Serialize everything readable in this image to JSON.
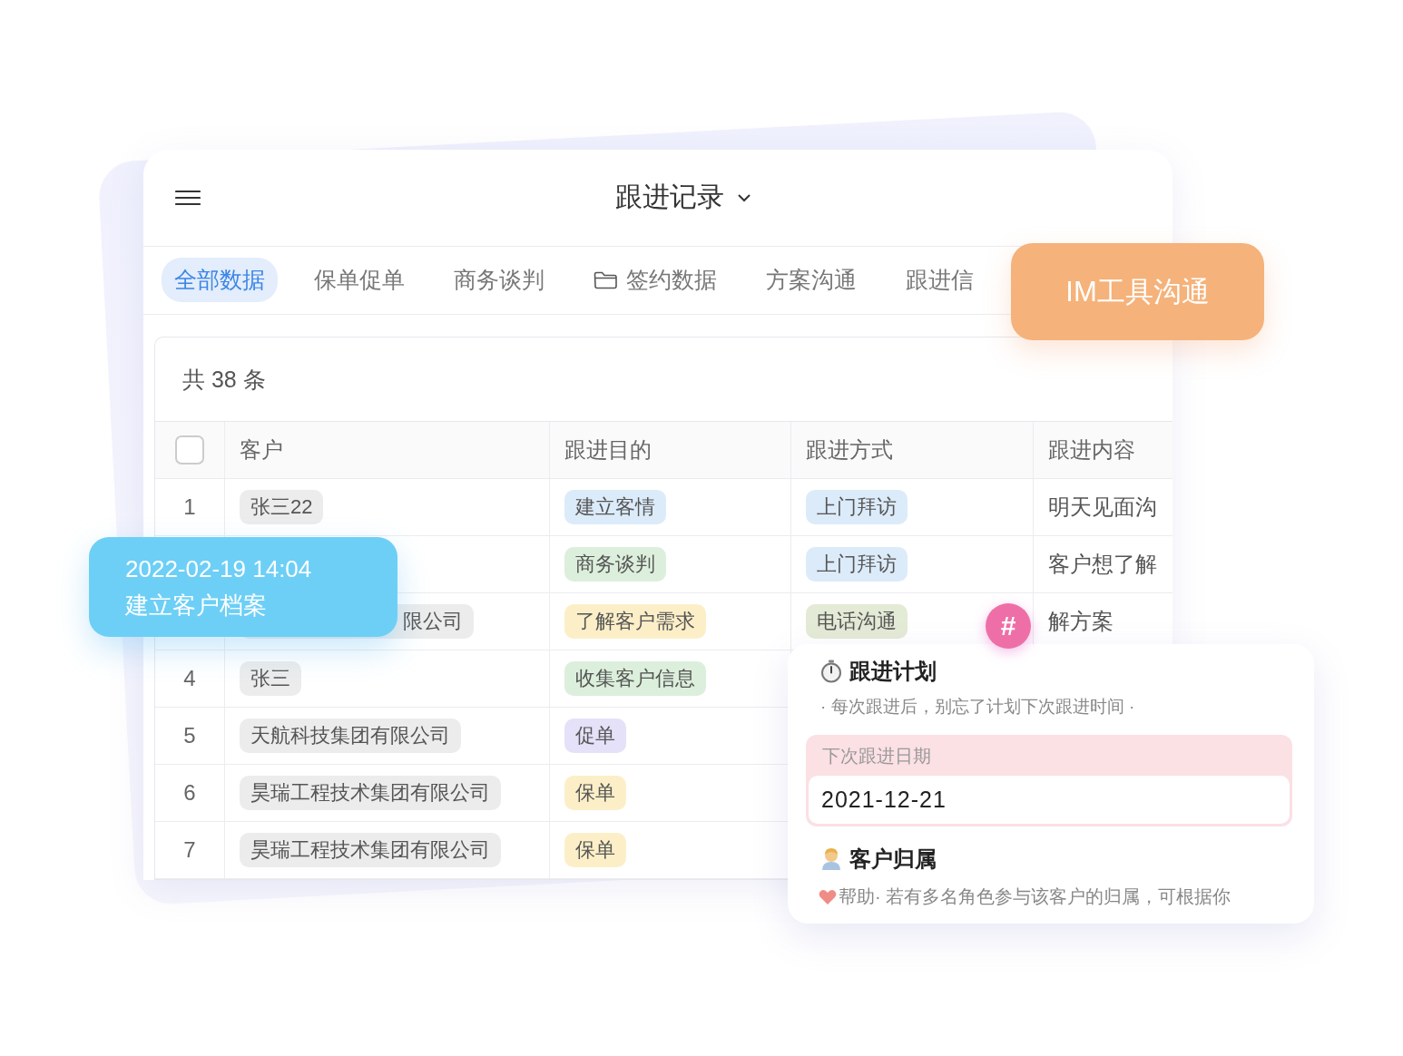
{
  "header": {
    "title": "跟进记录"
  },
  "tabs": [
    {
      "label": "全部数据",
      "selected": true,
      "kind": "text"
    },
    {
      "label": "保单促单",
      "selected": false,
      "kind": "text"
    },
    {
      "label": "商务谈判",
      "selected": false,
      "kind": "text"
    },
    {
      "label": "签约数据",
      "selected": false,
      "kind": "folder"
    },
    {
      "label": "方案沟通",
      "selected": false,
      "kind": "text"
    },
    {
      "label": "跟进信",
      "selected": false,
      "kind": "text"
    }
  ],
  "table": {
    "count": "共 38 条",
    "select_all": {
      "checked": false
    },
    "columns": [
      "客户",
      "跟进目的",
      "跟进方式",
      "跟进内容"
    ],
    "rows": [
      {
        "number": "1",
        "customer": {
          "text": "张三22",
          "kind": "full"
        },
        "purpose": {
          "text": "建立客情",
          "color": "#dcebfa"
        },
        "method": {
          "text": "上门拜访",
          "color": "#dcebfa"
        },
        "content": "明天见面沟"
      },
      {
        "purpose": {
          "text": "商务谈判",
          "color": "#dcefdc"
        },
        "method": {
          "text": "上门拜访",
          "color": "#dcebfa"
        },
        "content": "客户想了解"
      },
      {
        "customer": {
          "text": "限公司",
          "kind": "clipped"
        },
        "purpose": {
          "text": "了解客户需求",
          "color": "#fcefc8"
        },
        "method": {
          "text": "电话沟通",
          "color": "#e3ead5"
        },
        "content": "解方案"
      },
      {
        "number": "4",
        "customer": {
          "text": "张三",
          "kind": "full"
        },
        "purpose": {
          "text": "收集客户信息",
          "color": "#dcefdc"
        }
      },
      {
        "number": "5",
        "customer": {
          "text": "天航科技集团有限公司",
          "kind": "full"
        },
        "purpose": {
          "text": "促单",
          "color": "#e5e1f8"
        }
      },
      {
        "number": "6",
        "customer": {
          "text": "昊瑞工程技术集团有限公司",
          "kind": "full"
        },
        "purpose": {
          "text": "保单",
          "color": "#fcefc8"
        }
      },
      {
        "number": "7",
        "customer": {
          "text": "昊瑞工程技术集团有限公司",
          "kind": "full"
        },
        "purpose": {
          "text": "保单",
          "color": "#fcefc8"
        }
      }
    ]
  },
  "badge": {
    "label": "IM工具沟通"
  },
  "tooltip": {
    "lines": [
      "2022-02-19 14:04",
      "建立客户档案"
    ]
  },
  "plan_card": {
    "hash": "#",
    "title": "跟进计划",
    "subtitle": "· 每次跟进后，别忘了计划下次跟进时间 ·",
    "date_field": {
      "label": "下次跟进日期",
      "value": "2021-12-21"
    },
    "owner_title": "客户归属",
    "help": "帮助· 若有多名角色参与该客户的归属，可根据你"
  }
}
